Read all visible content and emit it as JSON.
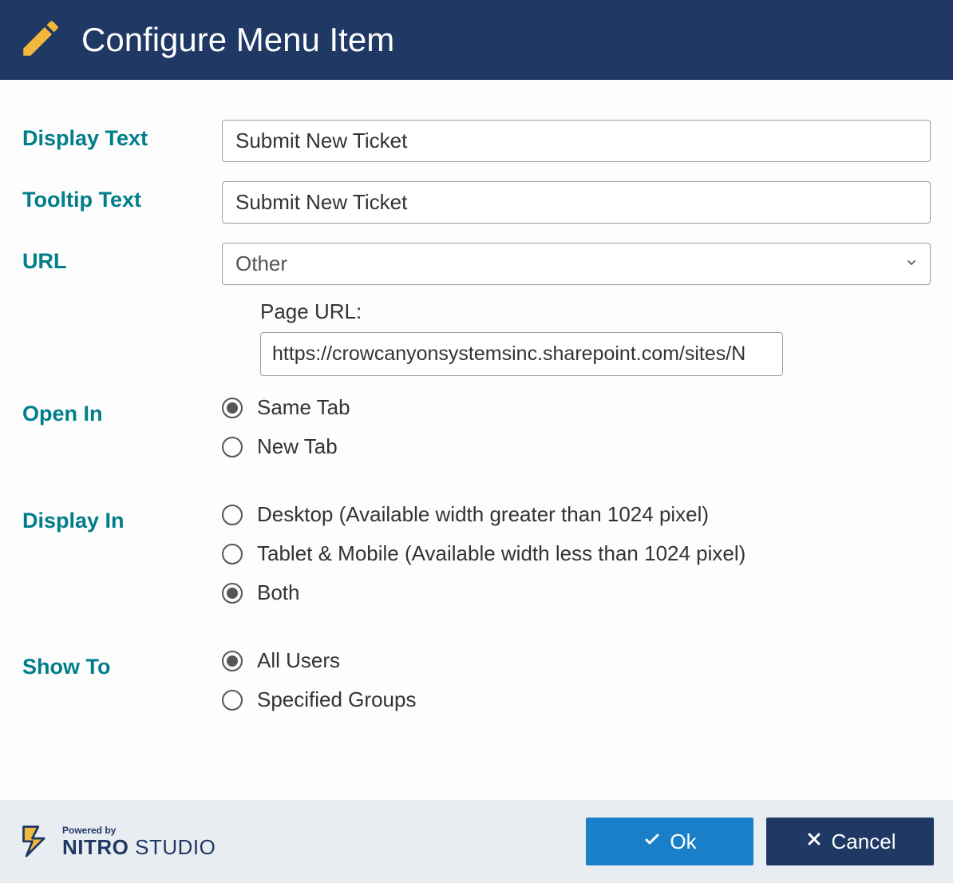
{
  "header": {
    "title": "Configure Menu Item"
  },
  "fields": {
    "display_text": {
      "label": "Display Text",
      "value": "Submit New Ticket"
    },
    "tooltip_text": {
      "label": "Tooltip Text",
      "value": "Submit New Ticket"
    },
    "url": {
      "label": "URL",
      "selected": "Other",
      "page_url_label": "Page URL:",
      "page_url_value": "https://crowcanyonsystemsinc.sharepoint.com/sites/N"
    },
    "open_in": {
      "label": "Open In",
      "options": [
        {
          "label": "Same Tab",
          "selected": true
        },
        {
          "label": "New Tab",
          "selected": false
        }
      ]
    },
    "display_in": {
      "label": "Display In",
      "options": [
        {
          "label": "Desktop (Available width greater than 1024 pixel)",
          "selected": false
        },
        {
          "label": "Tablet & Mobile (Available width less than 1024 pixel)",
          "selected": false
        },
        {
          "label": "Both",
          "selected": true
        }
      ]
    },
    "show_to": {
      "label": "Show To",
      "options": [
        {
          "label": "All Users",
          "selected": true
        },
        {
          "label": "Specified Groups",
          "selected": false
        }
      ]
    }
  },
  "footer": {
    "brand_powered": "Powered by",
    "brand_name_bold": "NITRO",
    "brand_name_light": " STUDIO",
    "ok": "Ok",
    "cancel": "Cancel"
  }
}
